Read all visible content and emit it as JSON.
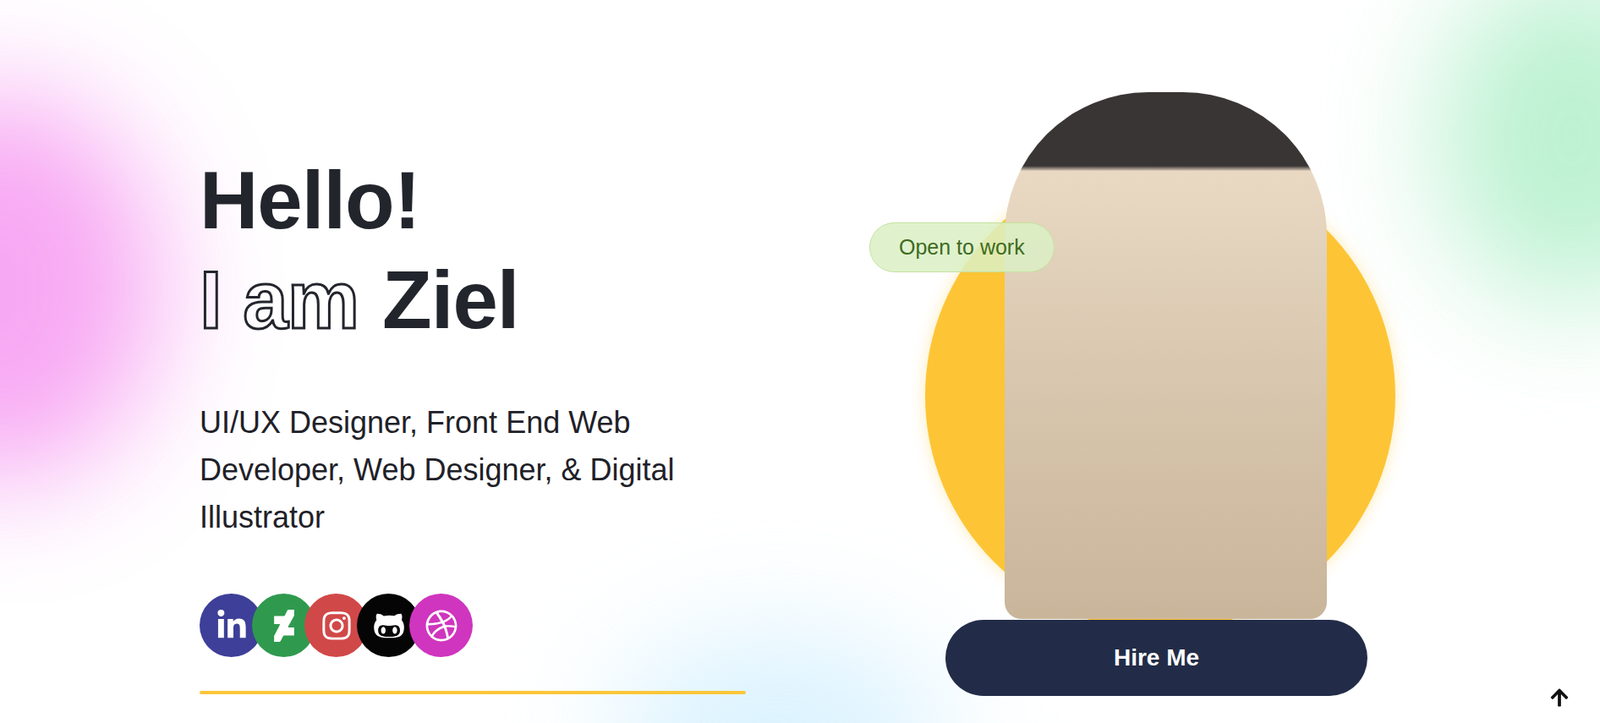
{
  "heading": {
    "greeting": "Hello!",
    "intro_outline": "I am",
    "name": "Ziel"
  },
  "roles": "UI/UX Designer, Front End Web Developer, Web Designer, & Digital Illustrator",
  "socials": [
    {
      "kind": "linkedin",
      "color": "#3d3f98"
    },
    {
      "kind": "deviantart",
      "color": "#2f9a4e"
    },
    {
      "kind": "instagram",
      "color": "#d14848"
    },
    {
      "kind": "github",
      "color": "#050505"
    },
    {
      "kind": "dribbble",
      "color": "#cf35be"
    }
  ],
  "badge": "Open to work",
  "cta": "Hire Me"
}
